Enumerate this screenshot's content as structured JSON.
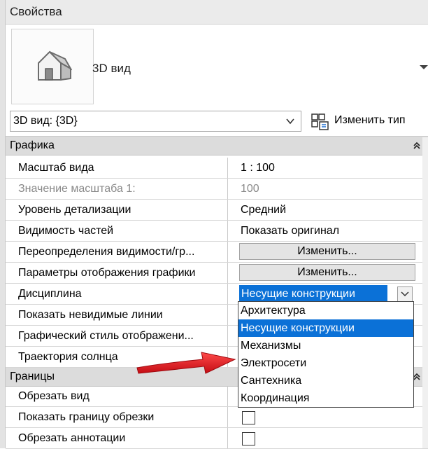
{
  "panel": {
    "title": "Свойства"
  },
  "type_preview": {
    "icon": "house-3d-view-icon",
    "type_name": "3D вид"
  },
  "instance_selector": {
    "value": "3D вид: {3D}"
  },
  "edit_type": {
    "label": "Изменить тип",
    "icon": "edit-type-icon"
  },
  "groups": {
    "graphics": {
      "label": "Графика"
    },
    "extents": {
      "label": "Границы"
    }
  },
  "rows": {
    "view_scale": {
      "name": "Масштаб вида",
      "value": "1 : 100"
    },
    "scale_value": {
      "name": "Значение масштаба    1:",
      "value": "100"
    },
    "detail_level": {
      "name": "Уровень детализации",
      "value": "Средний"
    },
    "parts_visibility": {
      "name": "Видимость частей",
      "value": "Показать оригинал"
    },
    "vg_overrides": {
      "name": "Переопределения видимости/гр...",
      "button": "Изменить..."
    },
    "graphic_display": {
      "name": "Параметры отображения графики",
      "button": "Изменить..."
    },
    "discipline": {
      "name": "Дисциплина",
      "value": "Несущие конструкции"
    },
    "hidden_lines": {
      "name": "Показать невидимые линии"
    },
    "graphic_style": {
      "name": "Графический стиль отображени..."
    },
    "sun_path": {
      "name": "Траектория солнца"
    },
    "crop_view": {
      "name": "Обрезать вид"
    },
    "crop_region_visible": {
      "name": "Показать границу обрезки"
    },
    "annotation_crop": {
      "name": "Обрезать аннотации"
    }
  },
  "discipline_options": [
    "Архитектура",
    "Несущие конструкции",
    "Механизмы",
    "Электросети",
    "Сантехника",
    "Координация"
  ],
  "colors": {
    "selection": "#0b71d7",
    "annotation_arrow": "#e8141c"
  }
}
